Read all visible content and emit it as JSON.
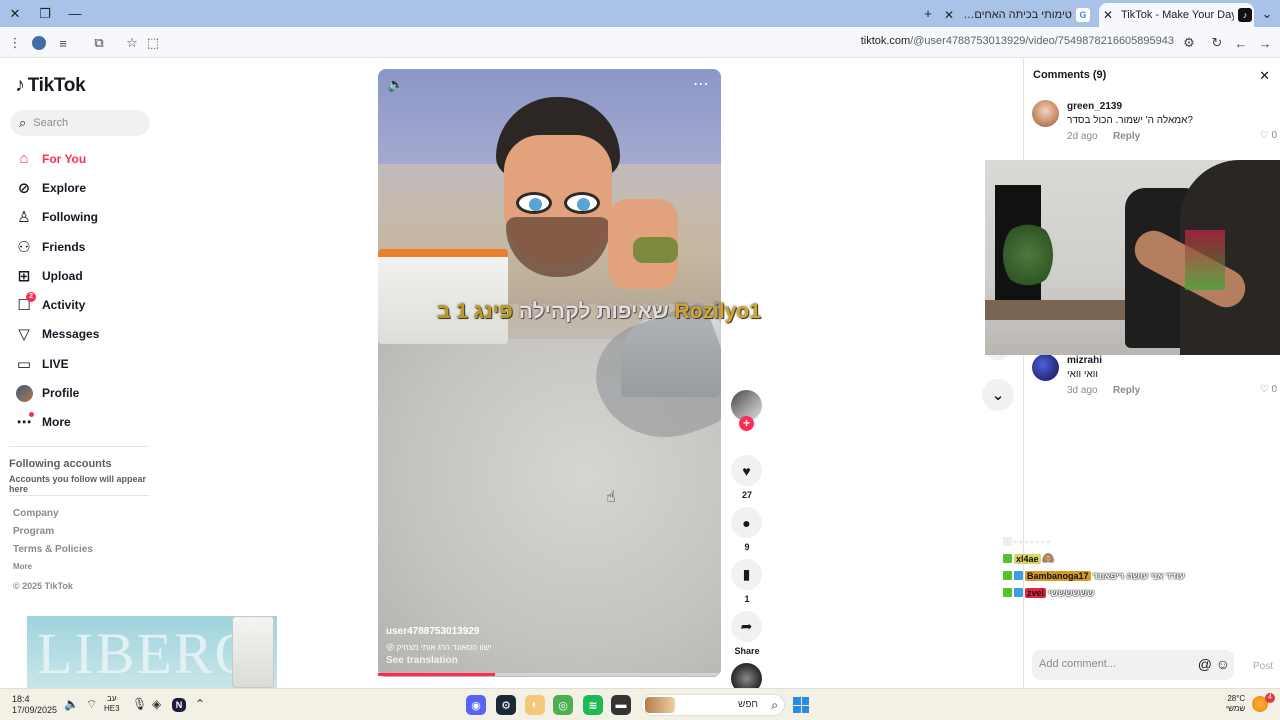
{
  "browser": {
    "tabs": [
      {
        "title": "TikTok - Make Your Day",
        "active": true
      },
      {
        "title": "טימותי בכיתה האחים - חיפוש ב",
        "active": false
      }
    ],
    "url_domain": "tiktok.com",
    "url_path": "/@user4788753013929/video/7549878216605895943"
  },
  "sidebar": {
    "brand": "TikTok",
    "search_placeholder": "Search",
    "nav": [
      {
        "label": "For You",
        "icon": "home-icon",
        "active": true
      },
      {
        "label": "Explore",
        "icon": "compass-icon"
      },
      {
        "label": "Following",
        "icon": "following-icon"
      },
      {
        "label": "Friends",
        "icon": "friends-icon"
      },
      {
        "label": "Upload",
        "icon": "upload-icon"
      },
      {
        "label": "Activity",
        "icon": "activity-icon",
        "badge": "2"
      },
      {
        "label": "Messages",
        "icon": "messages-icon"
      },
      {
        "label": "LIVE",
        "icon": "live-icon"
      },
      {
        "label": "Profile",
        "icon": "profile-avatar"
      },
      {
        "label": "More",
        "icon": "more-icon"
      }
    ],
    "following_title": "Following accounts",
    "following_sub": "Accounts you follow will appear here",
    "footer": [
      "Company",
      "Program",
      "Terms & Policies",
      "More"
    ],
    "copyright": "© 2025 TikTok"
  },
  "video": {
    "overlay_name": "Rozilyo1",
    "overlay_middle": "פינג 1 ב",
    "overlay_hebrew": "שאיפות לקהילה",
    "author": "user4788753013929",
    "description": "😜 ישוו הסאונד הרג אותי מצחיק",
    "see_translation": "See translation",
    "progress": 0.34
  },
  "actions": {
    "likes": "27",
    "comments": "9",
    "saves": "1",
    "share": "Share"
  },
  "comments": {
    "title": "Comments (9)",
    "items": [
      {
        "user": "green_2139",
        "text": "?אמאלה ה' ישמור. הכול בסדר",
        "time": "2d ago",
        "reply": "Reply",
        "likes": "0"
      },
      {
        "user": "mizrahi",
        "text": "וואי וואי",
        "time": "3d ago",
        "reply": "Reply",
        "likes": "0"
      }
    ],
    "input_placeholder": "Add comment...",
    "post": "Post"
  },
  "stream_chat": [
    {
      "user": "xl4ae",
      "message": "🙈",
      "color": "#d7d46a"
    },
    {
      "user": "Bambanoga17",
      "message": "עודד אני עושה ריפאונד",
      "color": "#d49a2a"
    },
    {
      "user": "zvei",
      "message": "ששששששי",
      "color": "#e0223c"
    }
  ],
  "ad": {
    "text": "LIBERO"
  },
  "taskbar": {
    "time": "18:4",
    "date": "17/09/2025",
    "lang_top": "עב",
    "lang_bottom": "HE3",
    "search_label": "חפש",
    "temp": "28°C",
    "weather_label": "שמשי",
    "notifications": "4"
  }
}
